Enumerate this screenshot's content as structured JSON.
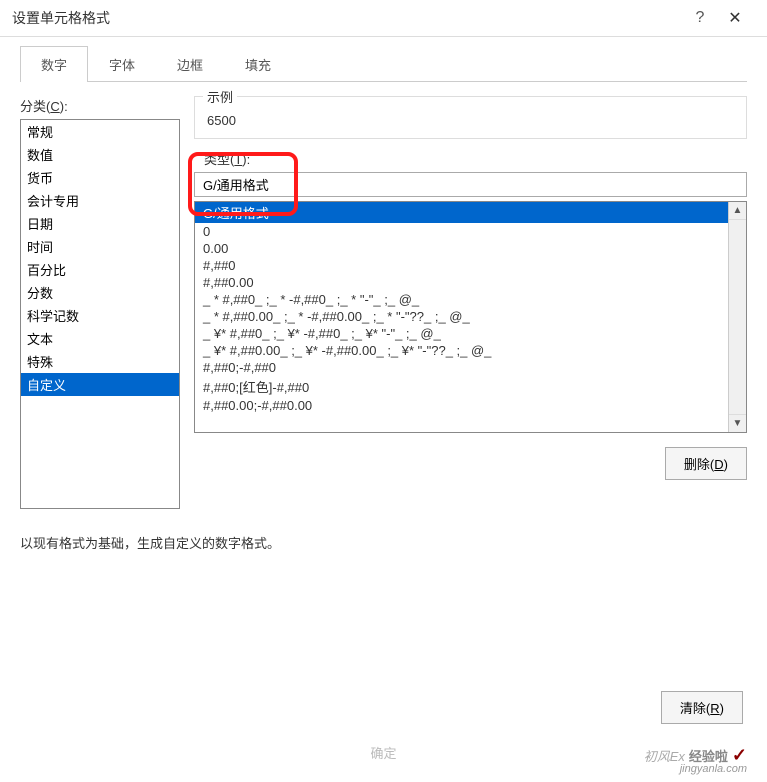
{
  "titlebar": {
    "title": "设置单元格格式",
    "help": "?",
    "close": "✕"
  },
  "tabs": [
    {
      "label": "数字",
      "active": true
    },
    {
      "label": "字体",
      "active": false
    },
    {
      "label": "边框",
      "active": false
    },
    {
      "label": "填充",
      "active": false
    }
  ],
  "left": {
    "category_label": "分类(C):",
    "categories": [
      {
        "label": "常规",
        "selected": false
      },
      {
        "label": "数值",
        "selected": false
      },
      {
        "label": "货币",
        "selected": false
      },
      {
        "label": "会计专用",
        "selected": false
      },
      {
        "label": "日期",
        "selected": false
      },
      {
        "label": "时间",
        "selected": false
      },
      {
        "label": "百分比",
        "selected": false
      },
      {
        "label": "分数",
        "selected": false
      },
      {
        "label": "科学记数",
        "selected": false
      },
      {
        "label": "文本",
        "selected": false
      },
      {
        "label": "特殊",
        "selected": false
      },
      {
        "label": "自定义",
        "selected": true
      }
    ]
  },
  "right": {
    "sample_label": "示例",
    "sample_value": "6500",
    "type_label": "类型(T):",
    "type_value": "G/通用格式",
    "formats": [
      {
        "label": "G/通用格式",
        "selected": true
      },
      {
        "label": "0",
        "selected": false
      },
      {
        "label": "0.00",
        "selected": false
      },
      {
        "label": "#,##0",
        "selected": false
      },
      {
        "label": "#,##0.00",
        "selected": false
      },
      {
        "label": "_ * #,##0_ ;_ * -#,##0_ ;_ * \"-\"_ ;_ @_ ",
        "selected": false
      },
      {
        "label": "_ * #,##0.00_ ;_ * -#,##0.00_ ;_ * \"-\"??_ ;_ @_ ",
        "selected": false
      },
      {
        "label": "_ ¥* #,##0_ ;_ ¥* -#,##0_ ;_ ¥* \"-\"_ ;_ @_ ",
        "selected": false
      },
      {
        "label": "_ ¥* #,##0.00_ ;_ ¥* -#,##0.00_ ;_ ¥* \"-\"??_ ;_ @_ ",
        "selected": false
      },
      {
        "label": "#,##0;-#,##0",
        "selected": false
      },
      {
        "label": "#,##0;[红色]-#,##0",
        "selected": false
      },
      {
        "label": "#,##0.00;-#,##0.00",
        "selected": false
      }
    ],
    "delete_label": "删除(D)",
    "scroll_up": "▲",
    "scroll_down": "▼"
  },
  "hint": "以现有格式为基础，生成自定义的数字格式。",
  "bottom": {
    "clear_label": "清除(R)",
    "ok_hint": "确定"
  },
  "watermark": {
    "text1": "初风Ex",
    "text2": "经验啦",
    "site": "jingyanla.com",
    "check": "✓"
  }
}
